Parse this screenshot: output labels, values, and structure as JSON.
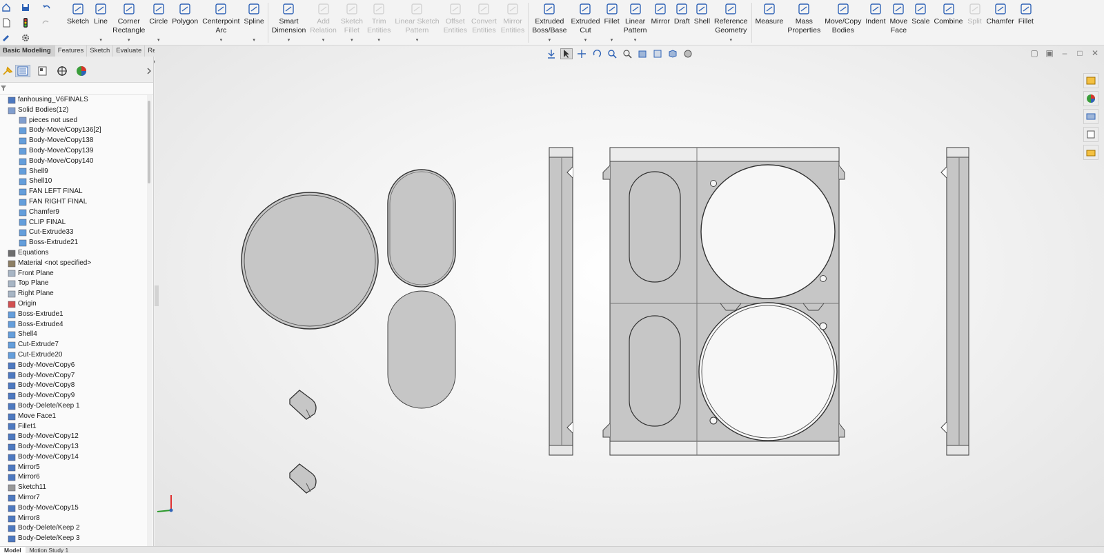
{
  "ribbon": {
    "tools": [
      {
        "id": "sketch",
        "label": "Sketch",
        "icon": "sketch-icon",
        "enabled": true,
        "arrow": false
      },
      {
        "id": "line",
        "label": "Line",
        "icon": "line-icon",
        "enabled": true,
        "arrow": true
      },
      {
        "id": "corner-rectangle",
        "label": "Corner\nRectangle",
        "icon": "rectangle-icon",
        "enabled": true,
        "arrow": true
      },
      {
        "id": "circle",
        "label": "Circle",
        "icon": "circle-icon",
        "enabled": true,
        "arrow": true
      },
      {
        "id": "polygon",
        "label": "Polygon",
        "icon": "polygon-icon",
        "enabled": true,
        "arrow": false
      },
      {
        "id": "centerpoint-arc",
        "label": "Centerpoint\nArc",
        "icon": "arc-icon",
        "enabled": true,
        "arrow": true
      },
      {
        "id": "spline",
        "label": "Spline",
        "icon": "spline-icon",
        "enabled": true,
        "arrow": true
      },
      {
        "sep": true
      },
      {
        "id": "smart-dimension",
        "label": "Smart\nDimension",
        "icon": "dimension-icon",
        "enabled": true,
        "arrow": true
      },
      {
        "id": "add-relation",
        "label": "Add\nRelation",
        "icon": "relation-icon",
        "enabled": false,
        "arrow": true
      },
      {
        "id": "sketch-fillet",
        "label": "Sketch\nFillet",
        "icon": "sketch-fillet-icon",
        "enabled": false,
        "arrow": true
      },
      {
        "id": "trim-entities",
        "label": "Trim\nEntities",
        "icon": "trim-icon",
        "enabled": false,
        "arrow": true
      },
      {
        "id": "linear-sketch-pattern",
        "label": "Linear Sketch\nPattern",
        "icon": "pattern-icon",
        "enabled": false,
        "arrow": true
      },
      {
        "id": "offset-entities",
        "label": "Offset\nEntities",
        "icon": "offset-icon",
        "enabled": false,
        "arrow": false
      },
      {
        "id": "convert-entities",
        "label": "Convert\nEntities",
        "icon": "convert-icon",
        "enabled": false,
        "arrow": false
      },
      {
        "id": "mirror-entities",
        "label": "Mirror\nEntities",
        "icon": "mirror-entities-icon",
        "enabled": false,
        "arrow": false
      },
      {
        "sep": true
      },
      {
        "id": "extruded-boss-base",
        "label": "Extruded\nBoss/Base",
        "icon": "extrude-boss-icon",
        "enabled": true,
        "arrow": true
      },
      {
        "id": "extruded-cut",
        "label": "Extruded\nCut",
        "icon": "extrude-cut-icon",
        "enabled": true,
        "arrow": true
      },
      {
        "id": "fillet",
        "label": "Fillet",
        "icon": "fillet-icon",
        "enabled": true,
        "arrow": true
      },
      {
        "id": "linear-pattern",
        "label": "Linear\nPattern",
        "icon": "linear-pattern-icon",
        "enabled": true,
        "arrow": true
      },
      {
        "id": "mirror",
        "label": "Mirror",
        "icon": "mirror-icon",
        "enabled": true,
        "arrow": false
      },
      {
        "id": "draft",
        "label": "Draft",
        "icon": "draft-icon",
        "enabled": true,
        "arrow": false
      },
      {
        "id": "shell",
        "label": "Shell",
        "icon": "shell-icon",
        "enabled": true,
        "arrow": false
      },
      {
        "id": "reference-geometry",
        "label": "Reference\nGeometry",
        "icon": "reference-geometry-icon",
        "enabled": true,
        "arrow": true
      },
      {
        "sep": true
      },
      {
        "id": "measure",
        "label": "Measure",
        "icon": "measure-icon",
        "enabled": true,
        "arrow": false
      },
      {
        "id": "mass-properties",
        "label": "Mass\nProperties",
        "icon": "mass-properties-icon",
        "enabled": true,
        "arrow": false
      },
      {
        "id": "move-copy-bodies",
        "label": "Move/Copy\nBodies",
        "icon": "move-copy-icon",
        "enabled": true,
        "arrow": false
      },
      {
        "id": "indent",
        "label": "Indent",
        "icon": "indent-icon",
        "enabled": true,
        "arrow": false
      },
      {
        "id": "move-face",
        "label": "Move\nFace",
        "icon": "move-face-icon",
        "enabled": true,
        "arrow": false
      },
      {
        "id": "scale",
        "label": "Scale",
        "icon": "scale-icon",
        "enabled": true,
        "arrow": false
      },
      {
        "id": "combine",
        "label": "Combine",
        "icon": "combine-icon",
        "enabled": true,
        "arrow": false
      },
      {
        "id": "split",
        "label": "Split",
        "icon": "split-icon",
        "enabled": false,
        "arrow": false
      },
      {
        "id": "chamfer",
        "label": "Chamfer",
        "icon": "chamfer-icon",
        "enabled": true,
        "arrow": false
      },
      {
        "id": "fillet2",
        "label": "Fillet",
        "icon": "fillet-icon",
        "enabled": true,
        "arrow": false
      }
    ]
  },
  "command_tabs": [
    "Basic Modeling Tools",
    "Features",
    "Sketch",
    "Evaluate",
    "Render Tools"
  ],
  "tree": [
    {
      "label": "fanhousing_V6FINALS",
      "icon": "part-icon",
      "indent": 0
    },
    {
      "label": "Solid Bodies(12)",
      "icon": "folder-icon",
      "indent": 0
    },
    {
      "label": "pieces not used",
      "icon": "folder-icon",
      "indent": 1
    },
    {
      "label": "Body-Move/Copy136[2]",
      "icon": "body-icon",
      "indent": 1
    },
    {
      "label": "Body-Move/Copy138",
      "icon": "body-icon",
      "indent": 1
    },
    {
      "label": "Body-Move/Copy139",
      "icon": "body-icon",
      "indent": 1
    },
    {
      "label": "Body-Move/Copy140",
      "icon": "body-icon",
      "indent": 1
    },
    {
      "label": "Shell9",
      "icon": "body-icon",
      "indent": 1
    },
    {
      "label": "Shell10",
      "icon": "body-icon",
      "indent": 1
    },
    {
      "label": "FAN LEFT FINAL",
      "icon": "body-icon",
      "indent": 1
    },
    {
      "label": "FAN RIGHT FINAL",
      "icon": "body-icon",
      "indent": 1
    },
    {
      "label": "Chamfer9",
      "icon": "body-icon",
      "indent": 1
    },
    {
      "label": "CLIP FINAL",
      "icon": "body-icon",
      "indent": 1
    },
    {
      "label": "Cut-Extrude33",
      "icon": "body-icon",
      "indent": 1
    },
    {
      "label": "Boss-Extrude21",
      "icon": "body-icon",
      "indent": 1
    },
    {
      "label": "Equations",
      "icon": "equations-icon",
      "indent": 0
    },
    {
      "label": "Material <not specified>",
      "icon": "material-icon",
      "indent": 0
    },
    {
      "label": "Front Plane",
      "icon": "plane-icon",
      "indent": 0
    },
    {
      "label": "Top Plane",
      "icon": "plane-icon",
      "indent": 0
    },
    {
      "label": "Right Plane",
      "icon": "plane-icon",
      "indent": 0
    },
    {
      "label": "Origin",
      "icon": "origin-icon",
      "indent": 0
    },
    {
      "label": "Boss-Extrude1",
      "icon": "feature-icon",
      "indent": 0
    },
    {
      "label": "Boss-Extrude4",
      "icon": "feature-icon",
      "indent": 0
    },
    {
      "label": "Shell4",
      "icon": "feature-icon",
      "indent": 0
    },
    {
      "label": "Cut-Extrude7",
      "icon": "feature-icon",
      "indent": 0
    },
    {
      "label": "Cut-Extrude20",
      "icon": "feature-icon",
      "indent": 0
    },
    {
      "label": "Body-Move/Copy6",
      "icon": "move-copy-icon",
      "indent": 0
    },
    {
      "label": "Body-Move/Copy7",
      "icon": "move-copy-icon",
      "indent": 0
    },
    {
      "label": "Body-Move/Copy8",
      "icon": "move-copy-icon",
      "indent": 0
    },
    {
      "label": "Body-Move/Copy9",
      "icon": "move-copy-icon",
      "indent": 0
    },
    {
      "label": "Body-Delete/Keep 1",
      "icon": "delete-body-icon",
      "indent": 0
    },
    {
      "label": "Move Face1",
      "icon": "move-face-icon",
      "indent": 0
    },
    {
      "label": "Fillet1",
      "icon": "fillet-icon",
      "indent": 0
    },
    {
      "label": "Body-Move/Copy12",
      "icon": "move-copy-icon",
      "indent": 0
    },
    {
      "label": "Body-Move/Copy13",
      "icon": "move-copy-icon",
      "indent": 0
    },
    {
      "label": "Body-Move/Copy14",
      "icon": "move-copy-icon",
      "indent": 0
    },
    {
      "label": "Mirror5",
      "icon": "mirror-icon",
      "indent": 0
    },
    {
      "label": "Mirror6",
      "icon": "mirror-icon",
      "indent": 0
    },
    {
      "label": "Sketch11",
      "icon": "sketch-icon",
      "indent": 0
    },
    {
      "label": "Mirror7",
      "icon": "mirror-icon",
      "indent": 0
    },
    {
      "label": "Body-Move/Copy15",
      "icon": "move-copy-icon",
      "indent": 0
    },
    {
      "label": "Mirror8",
      "icon": "mirror-icon",
      "indent": 0
    },
    {
      "label": "Body-Delete/Keep 2",
      "icon": "delete-body-icon",
      "indent": 0
    },
    {
      "label": "Body-Delete/Keep 3",
      "icon": "delete-body-icon",
      "indent": 0
    }
  ],
  "bottom_tabs": [
    "Model",
    "Motion Study 1"
  ],
  "colors": {
    "accent": "#2f63b6",
    "part_fill": "#c8c8c8",
    "part_stroke": "#3a3a3a"
  }
}
